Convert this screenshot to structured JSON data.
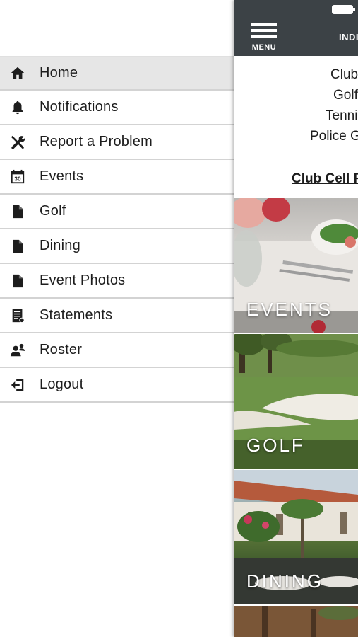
{
  "drawer": {
    "items": [
      {
        "label": "Home",
        "icon": "home-icon",
        "active": true
      },
      {
        "label": "Notifications",
        "icon": "bell-icon",
        "active": false
      },
      {
        "label": "Report a Problem",
        "icon": "tools-icon",
        "active": false
      },
      {
        "label": "Events",
        "icon": "calendar-icon",
        "active": false
      },
      {
        "label": "Golf",
        "icon": "document-icon",
        "active": false
      },
      {
        "label": "Dining",
        "icon": "document-icon",
        "active": false
      },
      {
        "label": "Event Photos",
        "icon": "document-icon",
        "active": false
      },
      {
        "label": "Statements",
        "icon": "statement-icon",
        "active": false
      },
      {
        "label": "Roster",
        "icon": "roster-icon",
        "active": false
      },
      {
        "label": "Logout",
        "icon": "logout-icon",
        "active": false
      }
    ],
    "calendar_day": "30"
  },
  "app": {
    "menu_label": "MENU",
    "header_title": "INDI",
    "info_lines": [
      "Club",
      "Golf",
      "Tenni",
      "Police G"
    ],
    "cell_link": "Club Cell P",
    "tiles": [
      {
        "label": "EVENTS"
      },
      {
        "label": "GOLF"
      },
      {
        "label": "DINING"
      }
    ]
  },
  "colors": {
    "header_bg": "#3c4246",
    "active_item_bg": "#e6e6e6",
    "divider": "#d3d3d3",
    "text": "#1d1d1d"
  }
}
